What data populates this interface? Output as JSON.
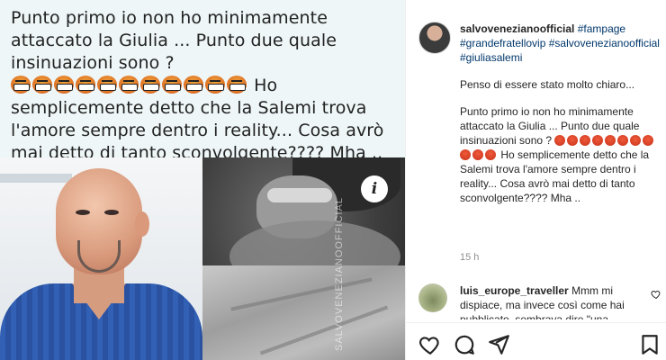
{
  "post": {
    "caption_line_1": "Punto primo io non ho minimamente attaccato la Giulia ... Punto due quale insinuazioni sono ?",
    "emoji_count": 11,
    "caption_line_2": " Ho semplicemente detto che la Salemi trova l'amore sempre dentro i reality... Cosa avrò mai detto di tanto sconvolgente???? Mha ..",
    "info_badge": "i",
    "watermark": "SALVOVENEZIANOOFFICIAL"
  },
  "panel": {
    "username": "salvoveneziano​official",
    "hashtags": [
      "#fampage",
      "#grandefratellovip",
      "#salvovenezianoofficial",
      "#giuliasalemi"
    ],
    "paragraph_1": "Penso di essere stato molto chiaro...",
    "paragraph_2a": "Punto primo io non ho minimamente attaccato la Giulia ... Punto due quale insinuazioni sono ?",
    "paragraph_2b": " Ho semplicemente detto che la Salemi trova l'amore sempre dentro i reality... Cosa avrò mai detto di tanto sconvolgente???? Mha ..",
    "timestamp": "15 h"
  },
  "comment": {
    "username": "luis_europe_traveller",
    "text": " Mmm mi dispiace, ma invece così come hai pubblicato, sembrava dire \"una"
  },
  "actions": {
    "icons": [
      "heart-icon",
      "comment-icon",
      "share-icon",
      "bookmark-icon"
    ]
  }
}
